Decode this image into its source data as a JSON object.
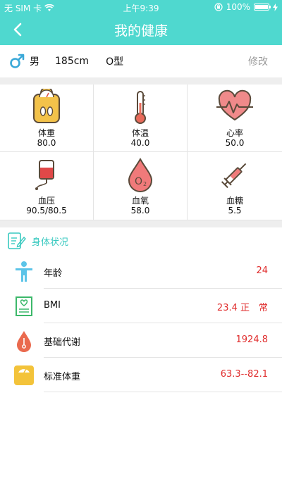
{
  "status_bar": {
    "carrier": "无 SIM 卡",
    "time": "上午9:39",
    "battery": "100%"
  },
  "nav": {
    "title": "我的健康",
    "back_icon": "chevron-left-icon"
  },
  "profile": {
    "gender": "男",
    "height": "185cm",
    "blood_type": "O型",
    "edit_label": "修改"
  },
  "metrics": [
    {
      "label": "体重",
      "value": "80.0",
      "icon": "scale-icon"
    },
    {
      "label": "体温",
      "value": "40.0",
      "icon": "thermometer-icon"
    },
    {
      "label": "心率",
      "value": "50.0",
      "icon": "heart-rate-icon"
    },
    {
      "label": "血压",
      "value": "90.5/80.5",
      "icon": "blood-bag-icon"
    },
    {
      "label": "血氧",
      "value": "58.0",
      "icon": "blood-drop-o2-icon"
    },
    {
      "label": "血糖",
      "value": "5.5",
      "icon": "syringe-icon"
    }
  ],
  "body_status": {
    "title": "身体状况",
    "items": [
      {
        "name": "年龄",
        "value": "24",
        "icon": "person-icon"
      },
      {
        "name": "BMI",
        "value": "23.4 正　常",
        "icon": "bmi-chart-icon"
      },
      {
        "name": "基础代谢",
        "value": "1924.8",
        "icon": "metabolism-drop-icon"
      },
      {
        "name": "标准体重",
        "value": "63.3--82.1",
        "icon": "weight-scale-icon"
      }
    ]
  },
  "colors": {
    "theme": "#4fd8cf",
    "accent_text": "#39c9c0",
    "value_red": "#e02d2d",
    "separator": "#eeeeee"
  }
}
